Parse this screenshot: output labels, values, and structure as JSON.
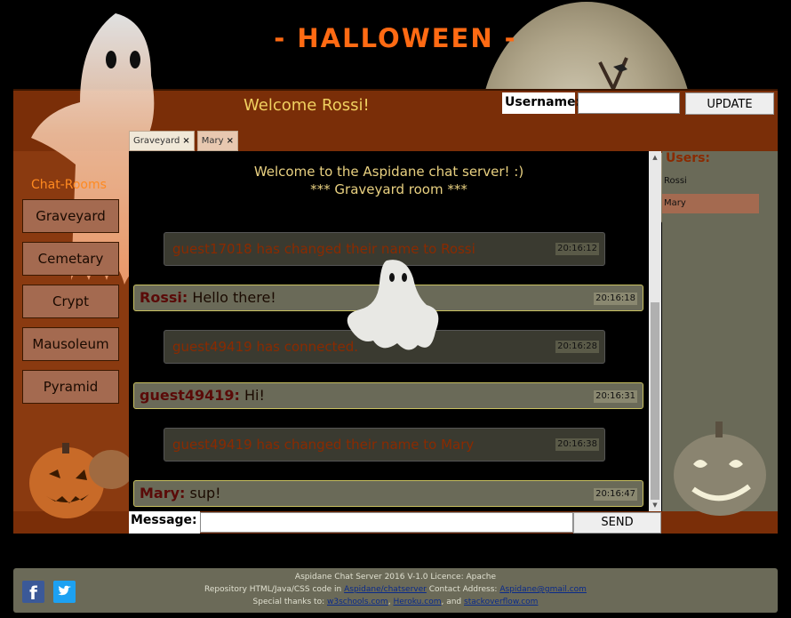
{
  "site": {
    "title": "- HALLOWEEN -"
  },
  "header": {
    "welcome": "Welcome Rossi!",
    "username_label": "Username:",
    "username_value": "",
    "update_label": "UPDATE"
  },
  "tabs": [
    {
      "label": "Graveyard",
      "close": "×",
      "active": true
    },
    {
      "label": "Mary",
      "close": "×",
      "active": false
    }
  ],
  "rooms": {
    "label": "Chat-Rooms",
    "items": [
      "Graveyard",
      "Cemetary",
      "Crypt",
      "Mausoleum",
      "Pyramid"
    ]
  },
  "chat": {
    "welcome_line1": "Welcome to the Aspidane chat server! :)",
    "welcome_line2": "*** Graveyard room ***",
    "messages": [
      {
        "kind": "server",
        "text": "guest17018 has changed their name to Rossi",
        "time": "20:16:12"
      },
      {
        "kind": "user",
        "sender": "Rossi:",
        "text": " Hello there!",
        "time": "20:16:18"
      },
      {
        "kind": "server",
        "text": "guest49419 has connected.",
        "time": "20:16:28"
      },
      {
        "kind": "user",
        "sender": "guest49419:",
        "text": " Hi!",
        "time": "20:16:31"
      },
      {
        "kind": "server",
        "text": "guest49419 has changed their name to Mary",
        "time": "20:16:38"
      },
      {
        "kind": "user",
        "sender": "Mary:",
        "text": " sup!",
        "time": "20:16:47"
      }
    ]
  },
  "users": {
    "label": "Users:",
    "items": [
      {
        "name": "Rossi",
        "selected": false
      },
      {
        "name": "Mary",
        "selected": true
      }
    ]
  },
  "composer": {
    "message_label": "Message:",
    "message_value": "",
    "send_label": "SEND"
  },
  "footer": {
    "line1": "Aspidane Chat Server 2016 V-1.0 Licence: Apache",
    "line2_prefix": "Repository HTML/Java/CSS code in ",
    "repo_link": "Aspidane/chatserver",
    "line2_mid": " Contact Address: ",
    "email_link": "Aspidane@gmail.com",
    "line3_prefix": "Special thanks to: ",
    "thanks1": "w3schools.com",
    "sep": ", ",
    "thanks2": "Heroku.com",
    "and": ", and ",
    "thanks3": "stackoverflow.com",
    "fb_glyph": "f"
  },
  "colors": {
    "title": "#ff6a13",
    "header_bar": "#7a2e08",
    "welcome": "#f0d060",
    "room_button": "#a46a50",
    "sender": "#5a0a08"
  }
}
